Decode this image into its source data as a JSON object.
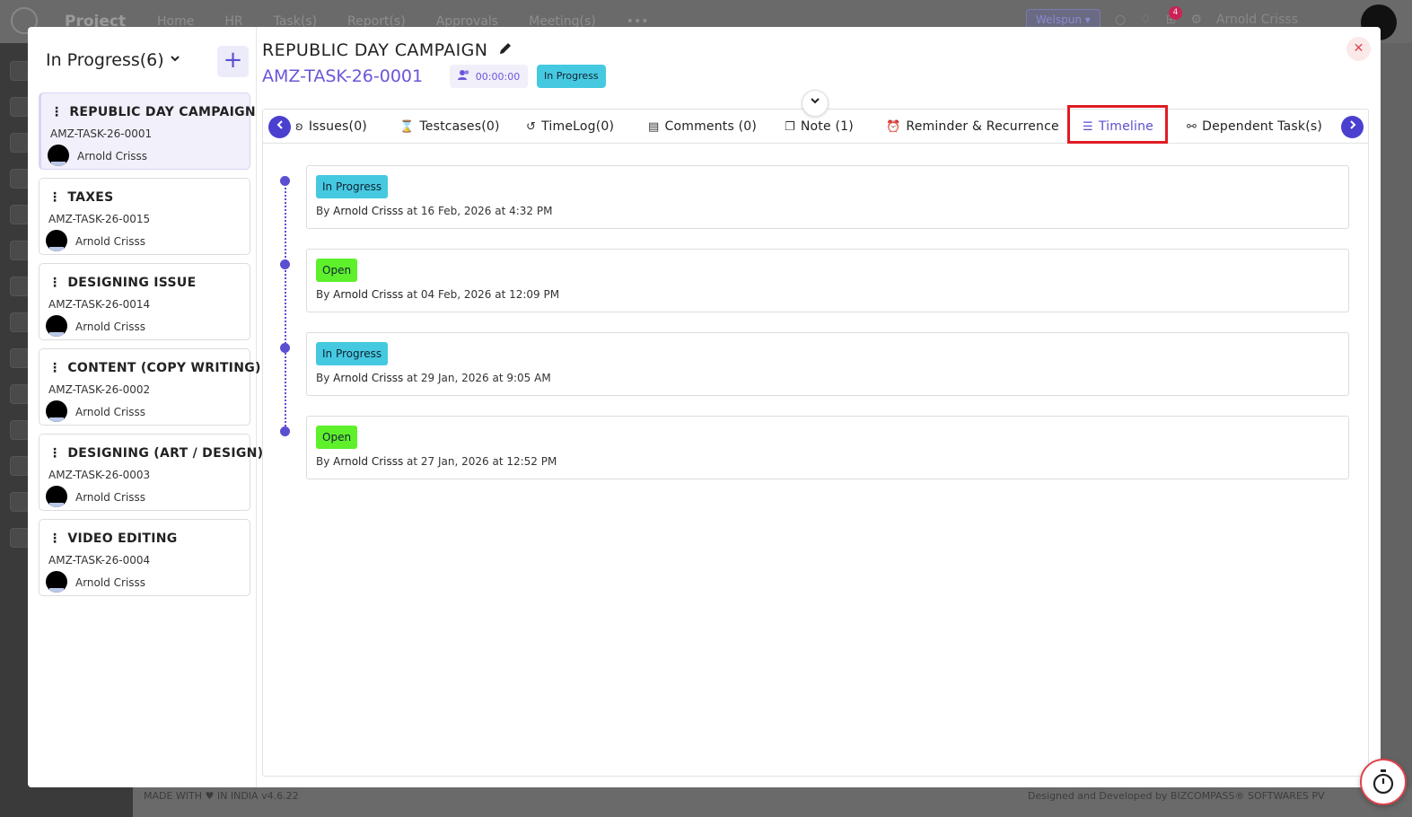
{
  "background": {
    "app_name": "Project",
    "nav": [
      "Home",
      "HR",
      "Task(s)",
      "Report(s)",
      "Approvals",
      "Meeting(s)",
      "•••"
    ],
    "company": "Welspun",
    "notification_count": "4",
    "user_name": "Arnold Crisss",
    "footer_made": "MADE WITH ♥ IN INDIA",
    "footer_version": "v4.6.22",
    "footer_designed": "Designed and Developed by BIZCOMPASS® SOFTWARES PV"
  },
  "left_panel": {
    "status_label": "In Progress(6)",
    "add_button": "+",
    "tasks": [
      {
        "title": "REPUBLIC DAY CAMPAIGN",
        "code": "AMZ-TASK-26-0001",
        "assignee": "Arnold Crisss"
      },
      {
        "title": "TAXES",
        "code": "AMZ-TASK-26-0015",
        "assignee": "Arnold Crisss"
      },
      {
        "title": "DESIGNING ISSUE",
        "code": "AMZ-TASK-26-0014",
        "assignee": "Arnold Crisss"
      },
      {
        "title": "CONTENT (COPY WRITING)",
        "code": "AMZ-TASK-26-0002",
        "assignee": "Arnold Crisss"
      },
      {
        "title": "DESIGNING (ART / DESIGN)",
        "code": "AMZ-TASK-26-0003",
        "assignee": "Arnold Crisss"
      },
      {
        "title": "VIDEO EDITING",
        "code": "AMZ-TASK-26-0004",
        "assignee": "Arnold Crisss"
      }
    ]
  },
  "task": {
    "title": "REPUBLIC DAY CAMPAIGN",
    "code": "AMZ-TASK-26-0001",
    "timer": "00:00:00",
    "status": "In Progress"
  },
  "tabs": [
    {
      "label": "Issues(0)",
      "icon": "bug-icon"
    },
    {
      "label": "Testcases(0)",
      "icon": "hourglass-icon"
    },
    {
      "label": "TimeLog(0)",
      "icon": "history-icon"
    },
    {
      "label": "Comments (0)",
      "icon": "comment-icon"
    },
    {
      "label": "Note (1)",
      "icon": "note-icon"
    },
    {
      "label": "Reminder & Recurrence",
      "icon": "alarm-icon"
    },
    {
      "label": "Timeline",
      "icon": "timeline-icon",
      "active": true
    },
    {
      "label": "Dependent Task(s)",
      "icon": "dependency-icon"
    }
  ],
  "timeline": [
    {
      "status": "In Progress",
      "by_prefix": "By",
      "user": "Arnold Crisss",
      "at": "at 16 Feb, 2026 at 4:32 PM"
    },
    {
      "status": "Open",
      "by_prefix": "By",
      "user": "Arnold Crisss",
      "at": "at 04 Feb, 2026 at 12:09 PM"
    },
    {
      "status": "In Progress",
      "by_prefix": "By",
      "user": "Arnold Crisss",
      "at": "at 29 Jan, 2026 at 9:05 AM"
    },
    {
      "status": "Open",
      "by_prefix": "By",
      "user": "Arnold Crisss",
      "at": "at 27 Jan, 2026 at 12:52 PM"
    }
  ],
  "colors": {
    "accent": "#5a4fd0",
    "in_progress": "#45c9e0",
    "open": "#5ef02b",
    "highlight": "#e01b24",
    "close": "#e0424c"
  }
}
